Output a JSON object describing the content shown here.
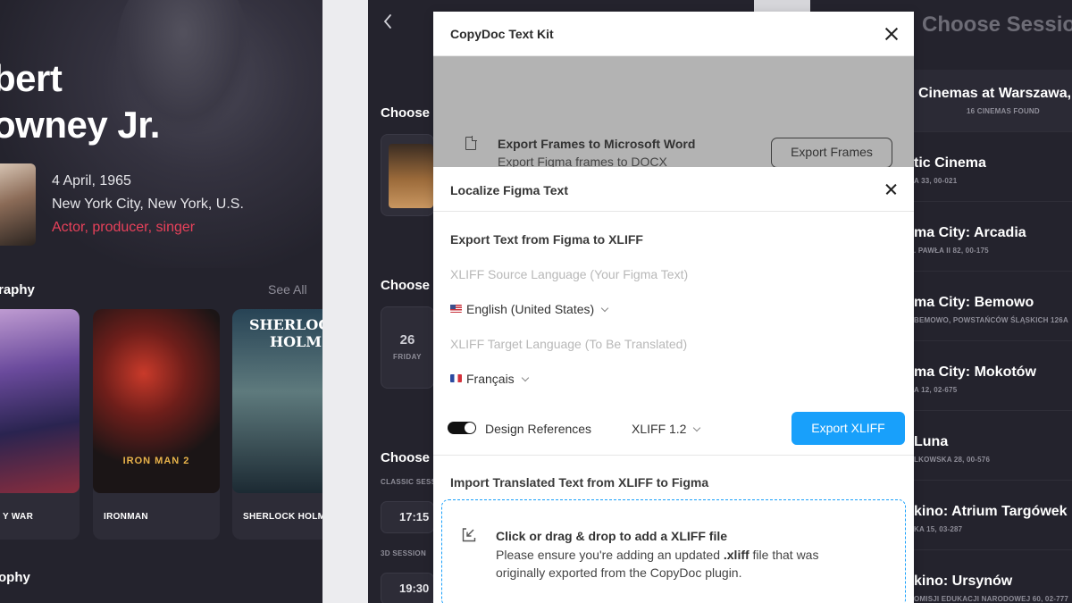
{
  "left_screen": {
    "name_line1": "bert",
    "name_line2": "owney Jr.",
    "birth_date": "4 April, 1965",
    "birth_place": "New York City, New York, U.S.",
    "roles": "Actor, producer, singer",
    "filmography_label": "raphy",
    "see_all": "See All",
    "biography_label": "ophy",
    "movies": [
      {
        "title": "Y WAR",
        "poster_text": ""
      },
      {
        "title": "IRONMAN",
        "poster_text": "IRON MAN 2"
      },
      {
        "title": "SHERLOCK HOLME",
        "poster_text": "SHERLOCK HOLM"
      }
    ]
  },
  "mid_screen": {
    "choose_1": "Choose",
    "choose_2": "Choose",
    "choose_3": "Choose",
    "date_num": "26",
    "date_day": "FRIDAY",
    "classic_label": "CLASSIC SESS",
    "time_1": "17:15",
    "session3d_label": "3D SESSION",
    "time_2": "19:30"
  },
  "right_screen": {
    "title": "Choose Sessio",
    "cinemas": [
      {
        "name": "Cinemas at Warszawa,",
        "addr": "16 CINEMAS FOUND"
      },
      {
        "name": "tic Cinema",
        "addr": "A 33, 00-021"
      },
      {
        "name": "ma City: Arcadia",
        "addr": ". PAWŁA II 82, 00-175"
      },
      {
        "name": "ma City: Bemowo",
        "addr": "BEMOWO, POWSTAŃCÓW ŚLĄSKICH 126A"
      },
      {
        "name": "ma City: Mokotów",
        "addr": "A 12, 02-675"
      },
      {
        "name": "Luna",
        "addr": "LKOWSKA 28, 00-576"
      },
      {
        "name": "kino: Atrium Targówek",
        "addr": "KA 15, 03-287"
      },
      {
        "name": "kino: Ursynów",
        "addr": "OMISJI EDUKACJI NARODOWEJ 60, 02-777"
      }
    ]
  },
  "plugin": {
    "title": "CopyDoc Text Kit",
    "export_frames": {
      "title": "Export Frames to Microsoft Word",
      "subtitle": "Export Figma frames to DOCX",
      "button": "Export Frames"
    },
    "localize": {
      "title": "Localize Figma Text",
      "export_section_title": "Export Text from Figma to XLIFF",
      "source_placeholder": "XLIFF Source Language (Your Figma Text)",
      "source_value": "English (United States)",
      "target_placeholder": "XLIFF Target Language (To Be Translated)",
      "target_value": "Français",
      "design_refs_label": "Design References",
      "design_refs_on": true,
      "xliff_version": "XLIFF 1.2",
      "export_button": "Export XLIFF",
      "import_section_title": "Import Translated Text from XLIFF to Figma",
      "dropzone_title": "Click or drag & drop to add a XLIFF file",
      "dropzone_text_before": "Please ensure you're adding an updated ",
      "dropzone_text_bold": ".xliff",
      "dropzone_text_after": " file that was originally exported from the CopyDoc plugin."
    },
    "accent_color": "#18a0fb"
  }
}
